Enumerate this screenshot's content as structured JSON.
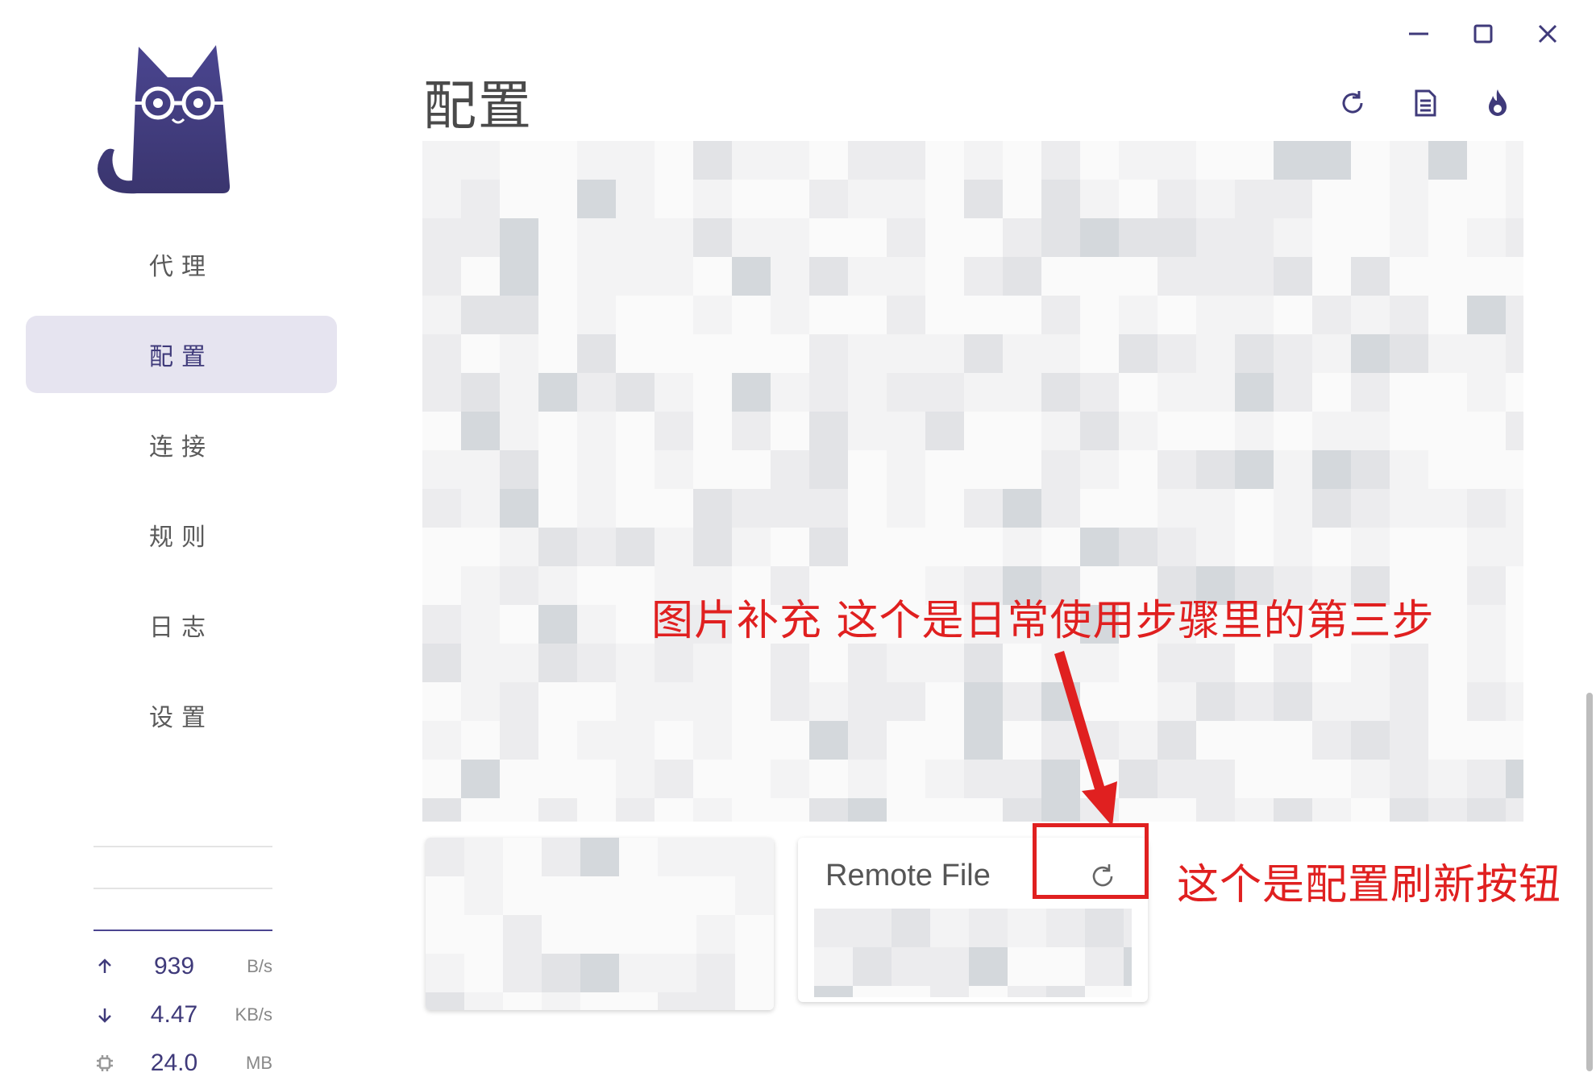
{
  "window": {
    "controls": [
      "minimize",
      "maximize",
      "close"
    ]
  },
  "sidebar": {
    "logo_icon": "cat-logo-icon",
    "items": [
      {
        "label": "代理",
        "active": false
      },
      {
        "label": "配置",
        "active": true
      },
      {
        "label": "连接",
        "active": false
      },
      {
        "label": "规则",
        "active": false
      },
      {
        "label": "日志",
        "active": false
      },
      {
        "label": "设置",
        "active": false
      }
    ],
    "stats": {
      "upload": {
        "value": "939",
        "unit": "B/s",
        "icon": "arrow-up-icon"
      },
      "download": {
        "value": "4.47",
        "unit": "KB/s",
        "icon": "arrow-down-icon"
      },
      "memory": {
        "value": "24.0",
        "unit": "MB",
        "icon": "chip-icon"
      }
    }
  },
  "header": {
    "title": "配置",
    "toolbar": [
      "refresh-icon",
      "document-icon",
      "fire-icon"
    ]
  },
  "cards": {
    "remote": {
      "title": "Remote File",
      "action_icon": "refresh-icon"
    }
  },
  "annotations": {
    "top_text": "图片补充  这个是日常使用步骤里的第三步",
    "right_text": "这个是配置刷新按钮",
    "color": "#e02020"
  },
  "colors": {
    "accent": "#3f3a7a",
    "active_bg": "#e6e4f0",
    "annotation": "#e02020"
  }
}
